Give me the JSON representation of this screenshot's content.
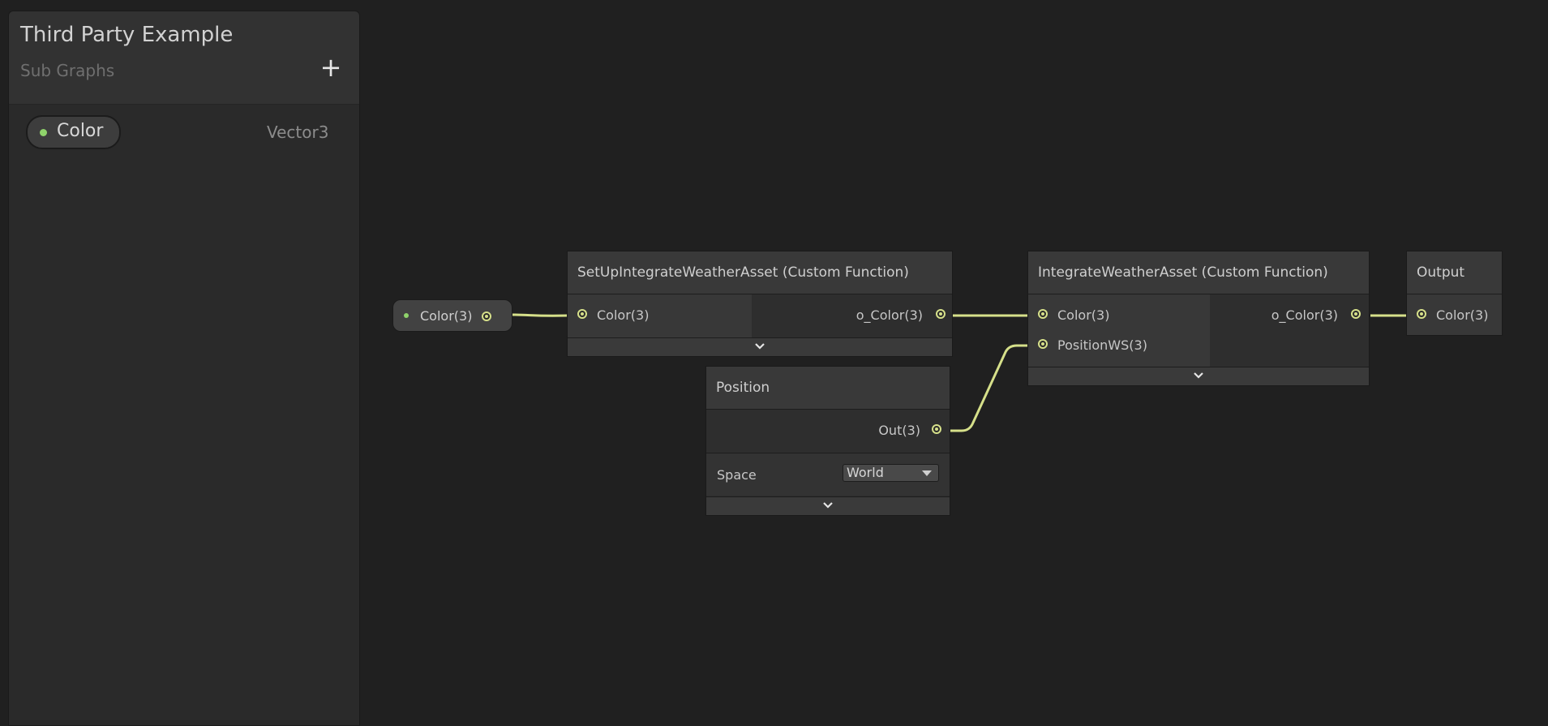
{
  "blackboard": {
    "title": "Third Party Example",
    "subtitle": "Sub Graphs",
    "add_label": "+",
    "properties": [
      {
        "name": "Color",
        "type": "Vector3"
      }
    ]
  },
  "graph": {
    "property_node": {
      "label": "Color(3)"
    },
    "setup_node": {
      "title": "SetUpIntegrateWeatherAsset (Custom Function)",
      "inputs": [
        "Color(3)"
      ],
      "outputs": [
        "o_Color(3)"
      ]
    },
    "position_node": {
      "title": "Position",
      "outputs": [
        "Out(3)"
      ],
      "space_label": "Space",
      "space_value": "World"
    },
    "integrate_node": {
      "title": "IntegrateWeatherAsset (Custom Function)",
      "inputs": [
        "Color(3)",
        "PositionWS(3)"
      ],
      "outputs": [
        "o_Color(3)"
      ]
    },
    "output_node": {
      "title": "Output",
      "inputs": [
        "Color(3)"
      ]
    }
  },
  "colors": {
    "wire": "#d6e08a",
    "property_dot": "#8fd36b",
    "background": "#202020"
  },
  "icons": {
    "add": "plus-icon",
    "expand": "chevron-down-icon",
    "dropdown": "triangle-down-icon"
  }
}
